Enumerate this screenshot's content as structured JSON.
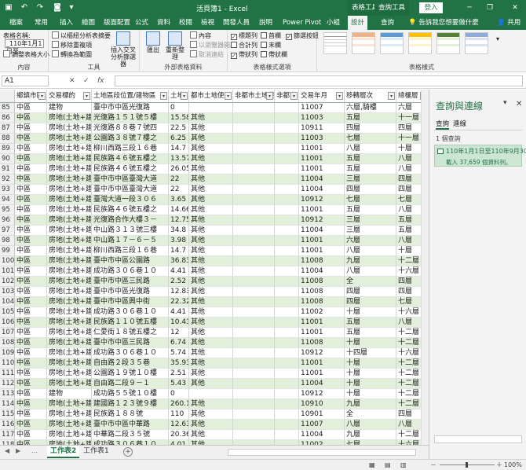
{
  "titlebar": {
    "doc_title": "活頁簿1 - Excel",
    "context_tab_1": "表格工具",
    "context_tab_2": "查詢工具",
    "login": "登入",
    "minimize": "─",
    "restore": "❐",
    "close": "✕"
  },
  "tabs": {
    "items": [
      "檔案",
      "常用",
      "插入",
      "繪圖",
      "版面配置",
      "公式",
      "資料",
      "校閱",
      "檢視",
      "開發人員",
      "說明",
      "Power Pivot",
      "小組",
      "設計",
      "查詢"
    ],
    "active_index": 13,
    "tell_me": "告訴我您想要做什麼",
    "share": "共用"
  },
  "ribbon": {
    "properties": {
      "label": "內容",
      "table_name_label": "表格名稱:",
      "table_name_value": "_110年1月1日至",
      "resize": "調整表格大小"
    },
    "tools": {
      "label": "工具",
      "summarize_pivot": "以樞紐分析表摘要",
      "remove_duplicates": "移除重複項",
      "convert_to_range": "轉換為範圍",
      "insert_slicer": "插入交叉分析篩選器"
    },
    "external": {
      "label": "外部表格資料",
      "export": "匯出",
      "refresh": "重新整理",
      "properties": "內容",
      "open_browser": "以瀏覽器開啟",
      "unlink": "取消連結"
    },
    "style_options": {
      "label": "表格樣式選項",
      "header_row": "標題列",
      "first_column": "首欄",
      "filter_button": "篩選按鈕",
      "total_row": "合計列",
      "last_column": "末欄",
      "banded_rows": "帶狀列",
      "banded_columns": "帶狀欄"
    },
    "styles": {
      "label": "表格樣式"
    }
  },
  "formula_bar": {
    "cell_ref": "A1",
    "cancel": "✕",
    "enter": "✓",
    "fx": "fx"
  },
  "grid": {
    "headers": [
      "鄉鎮市區",
      "交易標的",
      "土地區段位置/建物區",
      "土地",
      "都市土地使",
      "非都市土地使",
      "非都市",
      "交易年月",
      "移轉層次",
      "總樓層"
    ],
    "rows": [
      {
        "n": "85",
        "c": [
          "中區",
          "建物",
          "臺中市中區光復路",
          "0",
          "",
          "",
          "",
          "11007",
          "六層,騎樓",
          "六層"
        ]
      },
      {
        "n": "86",
        "c": [
          "中區",
          "房地(土地+建物)",
          "光復路１５１號５樓",
          "15.58",
          "其他",
          "",
          "",
          "11003",
          "五層",
          "十一層"
        ]
      },
      {
        "n": "87",
        "c": [
          "中區",
          "房地(土地+建物)",
          "光復路８８巷７號四",
          "22.5",
          "其他",
          "",
          "",
          "10911",
          "四層",
          "四層"
        ]
      },
      {
        "n": "88",
        "c": [
          "中區",
          "房地(土地+建物)",
          "公園路３８號７樓之",
          "6.25",
          "其他",
          "",
          "",
          "11003",
          "七層",
          "十一層"
        ]
      },
      {
        "n": "89",
        "c": [
          "中區",
          "房地(土地+建物)",
          "柳川西路三段１６巷",
          "14.7",
          "其他",
          "",
          "",
          "11001",
          "八層",
          "十層"
        ]
      },
      {
        "n": "90",
        "c": [
          "中區",
          "房地(土地+建物)",
          "民族路４６號五樓之",
          "13.57",
          "其他",
          "",
          "",
          "11001",
          "五層",
          "八層"
        ]
      },
      {
        "n": "91",
        "c": [
          "中區",
          "房地(土地+建物)",
          "民族路４６號五樓之",
          "26.05",
          "其他",
          "",
          "",
          "11001",
          "五層",
          "八層"
        ]
      },
      {
        "n": "92",
        "c": [
          "中區",
          "房地(土地+建物)",
          "臺中市中區臺灣大道",
          "22",
          "其他",
          "",
          "",
          "11004",
          "三層",
          "四層"
        ]
      },
      {
        "n": "93",
        "c": [
          "中區",
          "房地(土地+建物)",
          "臺中市中區臺灣大道",
          "22",
          "其他",
          "",
          "",
          "11004",
          "四層",
          "四層"
        ]
      },
      {
        "n": "94",
        "c": [
          "中區",
          "房地(土地+建物)",
          "臺灣大道一段３０６",
          "3.65",
          "其他",
          "",
          "",
          "10912",
          "七層",
          "七層"
        ]
      },
      {
        "n": "95",
        "c": [
          "中區",
          "房地(土地+建物)",
          "民族路４６號五樓之",
          "14.66",
          "其他",
          "",
          "",
          "11001",
          "五層",
          "八層"
        ]
      },
      {
        "n": "96",
        "c": [
          "中區",
          "房地(土地+建物)",
          "光復路合作大樓３－",
          "12.75",
          "其他",
          "",
          "",
          "10912",
          "三層",
          "五層"
        ]
      },
      {
        "n": "97",
        "c": [
          "中區",
          "房地(土地+建物)",
          "中山路３１３號三樓",
          "34.8",
          "其他",
          "",
          "",
          "11004",
          "三層",
          "五層"
        ]
      },
      {
        "n": "98",
        "c": [
          "中區",
          "房地(土地+建物)",
          "中山路１７－６－５",
          "3.98",
          "其他",
          "",
          "",
          "11001",
          "六層",
          "八層"
        ]
      },
      {
        "n": "99",
        "c": [
          "中區",
          "房地(土地+建物)",
          "柳川西路三段１６巷",
          "14.7",
          "其他",
          "",
          "",
          "11001",
          "八層",
          "十層"
        ]
      },
      {
        "n": "100",
        "c": [
          "中區",
          "房地(土地+建物)",
          "臺中市中區公園路",
          "36.83",
          "其他",
          "",
          "",
          "11008",
          "九層",
          "十二層"
        ]
      },
      {
        "n": "101",
        "c": [
          "中區",
          "房地(土地+建物)",
          "成功路３０６巷１０",
          "4.41",
          "其他",
          "",
          "",
          "11004",
          "八層",
          "十六層"
        ]
      },
      {
        "n": "102",
        "c": [
          "中區",
          "房地(土地+建物)",
          "臺中市中區三民路",
          "2.52",
          "其他",
          "",
          "",
          "11008",
          "全",
          "四層"
        ]
      },
      {
        "n": "103",
        "c": [
          "中區",
          "房地(土地+建物)",
          "臺中市中區光復路",
          "12.83",
          "其他",
          "",
          "",
          "11008",
          "四層",
          "四層"
        ]
      },
      {
        "n": "104",
        "c": [
          "中區",
          "房地(土地+建物)",
          "臺中市中區興中街",
          "22.32",
          "其他",
          "",
          "",
          "11008",
          "四層",
          "七層"
        ]
      },
      {
        "n": "105",
        "c": [
          "中區",
          "房地(土地+建物)",
          "成功路３０６巷１０",
          "4.41",
          "其他",
          "",
          "",
          "11002",
          "十層",
          "十六層"
        ]
      },
      {
        "n": "106",
        "c": [
          "中區",
          "房地(土地+建物)",
          "民族路１１０號五樓",
          "10.43",
          "其他",
          "",
          "",
          "11001",
          "五層",
          "八層"
        ]
      },
      {
        "n": "107",
        "c": [
          "中區",
          "房地(土地+建物)",
          "仁愛街１８號五樓之",
          "12",
          "其他",
          "",
          "",
          "11001",
          "五層",
          "十二層"
        ]
      },
      {
        "n": "108",
        "c": [
          "中區",
          "房地(土地+建物)",
          "臺中市中區三民路",
          "6.74",
          "其他",
          "",
          "",
          "11008",
          "十層",
          "十二層"
        ]
      },
      {
        "n": "109",
        "c": [
          "中區",
          "房地(土地+建物)",
          "成功路３０６巷１０",
          "5.74",
          "其他",
          "",
          "",
          "10912",
          "十四層",
          "十六層"
        ]
      },
      {
        "n": "110",
        "c": [
          "中區",
          "房地(土地+建物)",
          "自由路２段３５巷",
          "35.93",
          "其他",
          "",
          "",
          "11001",
          "十層",
          "十二層"
        ]
      },
      {
        "n": "111",
        "c": [
          "中區",
          "房地(土地+建物)",
          "公園路１９號１０樓",
          "2.51",
          "其他",
          "",
          "",
          "11001",
          "十層",
          "十二層"
        ]
      },
      {
        "n": "112",
        "c": [
          "中區",
          "房地(土地+建物)",
          "自由路二段９－１",
          "5.43",
          "其他",
          "",
          "",
          "11004",
          "十層",
          "十二層"
        ]
      },
      {
        "n": "113",
        "c": [
          "中區",
          "建物",
          "成功路５５號１０樓",
          "0",
          "",
          "",
          "",
          "10912",
          "十層",
          "十二層"
        ]
      },
      {
        "n": "114",
        "c": [
          "中區",
          "房地(土地+建物)",
          "建國路１２３號９樓",
          "260.13",
          "其他",
          "",
          "",
          "10910",
          "九層",
          "十二層"
        ]
      },
      {
        "n": "115",
        "c": [
          "中區",
          "房地(土地+建物)",
          "民族路１８８號",
          "110",
          "其他",
          "",
          "",
          "10901",
          "全",
          "四層"
        ]
      },
      {
        "n": "116",
        "c": [
          "中區",
          "房地(土地+建物)",
          "臺中市中區中華路",
          "12.63",
          "其他",
          "",
          "",
          "11007",
          "八層",
          "八層"
        ]
      },
      {
        "n": "117",
        "c": [
          "中區",
          "房地(土地+建物)",
          "中華路二段３５號",
          "20.36",
          "其他",
          "",
          "",
          "11004",
          "九層",
          "十二層"
        ]
      },
      {
        "n": "118",
        "c": [
          "中區",
          "房地(土地+建物)",
          "成功路３０６巷１０",
          "4.01",
          "其他",
          "",
          "",
          "11002",
          "七層",
          "十六層"
        ]
      },
      {
        "n": "119",
        "c": [
          "中區",
          "房地(土地+建物)",
          "成功路３０６巷１０",
          "4.01",
          "其他",
          "",
          "",
          "11002",
          "七層",
          "十六層"
        ]
      }
    ]
  },
  "pane": {
    "title": "查詢與連線",
    "tab_queries": "查詢",
    "tab_connections": "連線",
    "count": "1 個查詢",
    "query_name": "110年1月1日至110年9月30",
    "query_info": "載入 37,659 個資料列。"
  },
  "sheets": {
    "items": [
      "工作表2",
      "工作表1"
    ],
    "active_index": 0,
    "add": "+"
  },
  "status": {
    "zoom": "100%",
    "zoom_minus": "－",
    "zoom_plus": "＋"
  },
  "colors": {
    "accent": "#217346",
    "band": "#e2efda"
  }
}
